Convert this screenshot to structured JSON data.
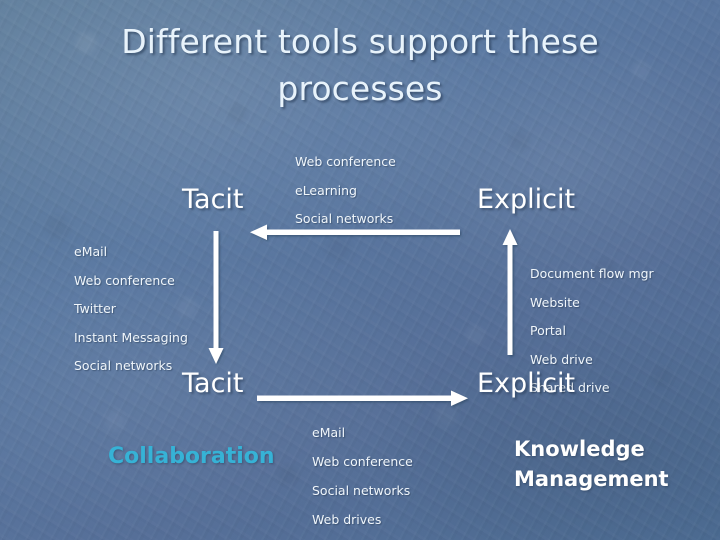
{
  "slide": {
    "title": "Different tools support these processes",
    "background_color": "#5d7ba3",
    "text_color": "#ffffff",
    "accent_color": "#36b2d6"
  },
  "top_section": {
    "left_pole_label": "Tacit",
    "right_pole_label": "Explicit",
    "tools": [
      "Web conference",
      "eLearning",
      "Social networks"
    ],
    "arrow": {
      "name": "arrow-right-to-left",
      "direction": "left",
      "label": "explicit to tacit"
    }
  },
  "middle_section": {
    "left_tools": [
      "eMail",
      "Web conference",
      "Twitter",
      "Instant Messaging",
      "Social networks"
    ],
    "right_tools": [
      "Document flow mgr",
      "Website",
      "Portal",
      "Web drive",
      "Shared drive"
    ],
    "left_arrow": {
      "name": "arrow-down",
      "direction": "down"
    },
    "right_arrow": {
      "name": "arrow-up",
      "direction": "up"
    }
  },
  "bottom_section": {
    "left_pole_label": "Tacit",
    "right_pole_label": "Explicit",
    "arrow": {
      "name": "arrow-left-to-right",
      "direction": "right",
      "label": "tacit to explicit"
    },
    "tools": [
      "eMail",
      "Web conference",
      "Social networks",
      "Web drives"
    ],
    "left_emphasis": "Collaboration",
    "right_emphasis_line1": "Knowledge",
    "right_emphasis_line2": "Management"
  }
}
